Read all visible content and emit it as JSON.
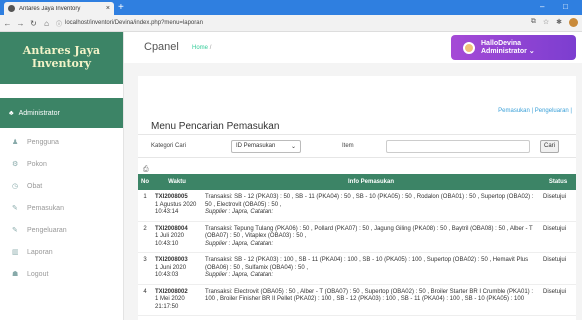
{
  "browser": {
    "tab_title": "Antares Jaya Inventory",
    "tab_close": "×",
    "new_tab": "+",
    "min": "–",
    "max": "□",
    "url": "localhost/inventori/Devina/index.php?menu=laporan"
  },
  "sidebar": {
    "brand_line1": "Antares Jaya",
    "brand_line2": "Inventory",
    "user_label": "Administrator",
    "items": [
      {
        "label": "Pengguna",
        "icon": "user-icon"
      },
      {
        "label": "Pokon",
        "icon": "gear-icon"
      },
      {
        "label": "Obat",
        "icon": "clock-icon"
      },
      {
        "label": "Pemasukan",
        "icon": "wrench-icon"
      },
      {
        "label": "Pengeluaran",
        "icon": "wrench-icon"
      },
      {
        "label": "Laporan",
        "icon": "chart-icon"
      },
      {
        "label": "Logout",
        "icon": "logout-icon"
      }
    ]
  },
  "topbar": {
    "app": "Cpanel",
    "crumb_home": "Home",
    "crumb_sep": "/",
    "user_line1": "HalloDevina",
    "user_line2": "Administrator ⌄"
  },
  "page": {
    "links": "Pemasukan | Pengeluaran |",
    "title": "Menu Pencarian Pemasukan",
    "search": {
      "kategori_label": "Kategori Cari",
      "selected": "ID Pemasukan",
      "item_label": "Item",
      "button": "Cari"
    },
    "table": {
      "headers": [
        "No",
        "Waktu",
        "Info Pemasukan",
        "Status"
      ],
      "rows": [
        {
          "no": "1",
          "code": "TXI2008005",
          "date": "1 Agustus 2020",
          "time": "10:43:14",
          "info": "Transaksi: SB - 12 (PKA03) : 50 , SB - 11 (PKA04) : 50 , SB - 10 (PKA05) : 50 , Rodalon (OBA01) : 50 , Supertop (OBA02) : 50 , Electrovit (OBA05) : 50 ,",
          "supplier": "Supplier : Japra, Catatan:",
          "status": "Disetujui"
        },
        {
          "no": "2",
          "code": "TXI2008004",
          "date": "1 Juli 2020",
          "time": "10:43:10",
          "info": "Transaksi: Tepung Tulang (PKA06) : 50 , Pollard (PKA07) : 50 , Jagung Giling (PKA08) : 50 , Baytril (OBA08) : 50 , Alber - T (OBA07) : 50 , Vitaplex (OBA03) : 50 ,",
          "supplier": "Supplier : Japra, Catatan:",
          "status": "Disetujui"
        },
        {
          "no": "3",
          "code": "TXI2008003",
          "date": "1 Juni 2020",
          "time": "10:43:03",
          "info": "Transaksi: SB - 12 (PKA03) : 100 , SB - 11 (PKA04) : 100 , SB - 10 (PKA05) : 100 , Supertop (OBA02) : 50 , Hemavit Plus (OBA06) : 50 , Sulfamix (OBA04) : 50 ,",
          "supplier": "Supplier : Japra, Catatan:",
          "status": "Disetujui"
        },
        {
          "no": "4",
          "code": "TXI2008002",
          "date": "1 Mei 2020",
          "time": "21:17:50",
          "info": "Transaksi: Electrovit (OBA05) : 50 , Alber - T (OBA07) : 50 , Supertop (OBA02) : 50 , Broiler Starter BR I Crumble (PKA01) : 100 , Broiler Finisher BR II Pellet (PKA02) : 100 , SB - 12 (PKA03) : 100 , SB - 11 (PKA04) : 100 , SB - 10 (PKA05) : 100",
          "supplier": "",
          "status": "Disetujui"
        }
      ]
    }
  }
}
